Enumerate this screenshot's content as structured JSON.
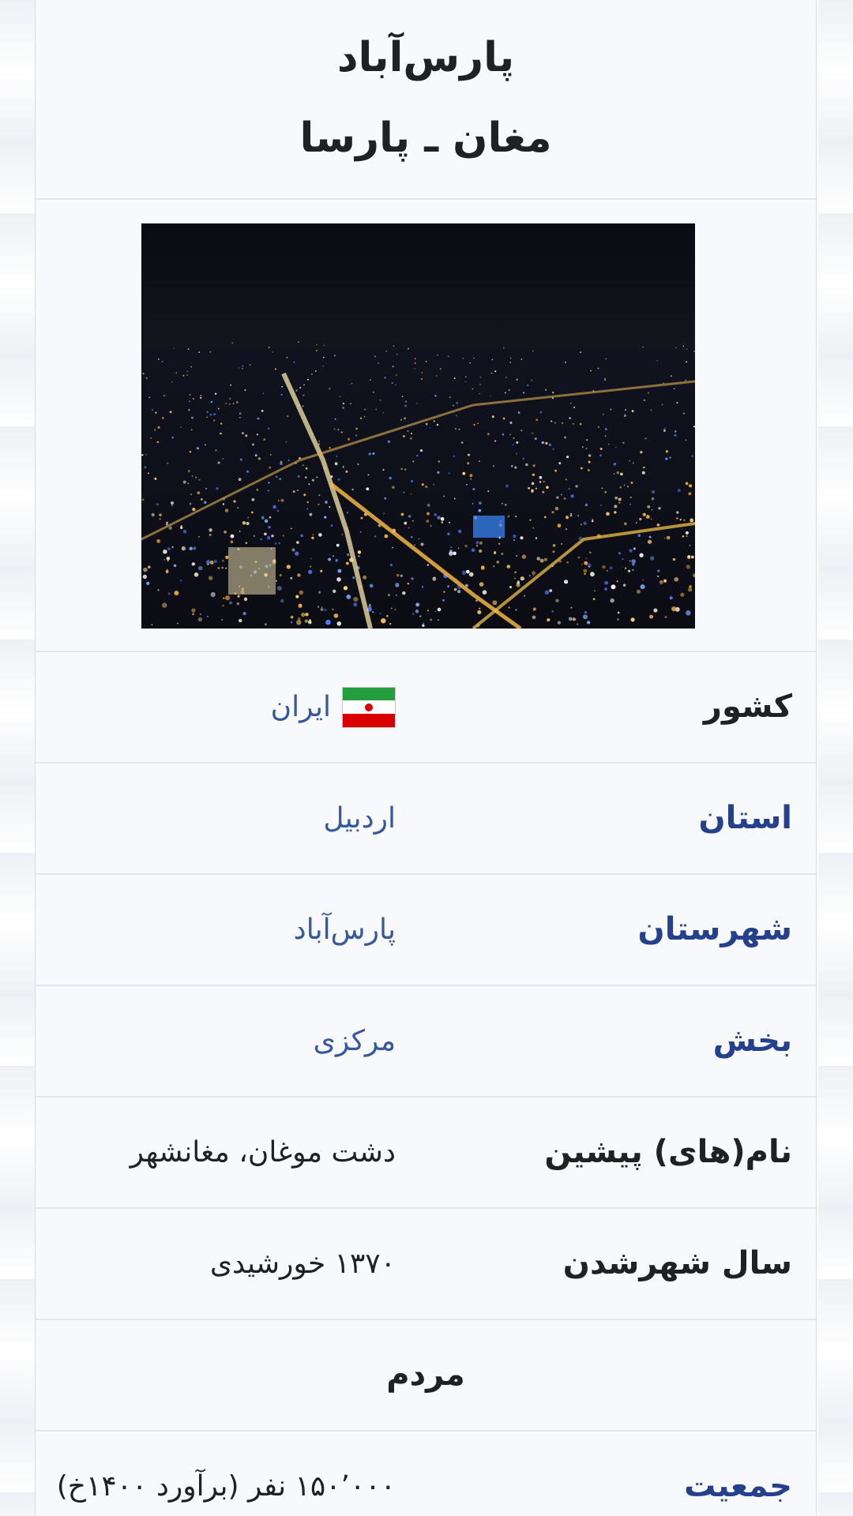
{
  "infobox": {
    "title": "پارس‌آباد",
    "subtitle": "مغان ـ پارسا"
  },
  "rows": [
    {
      "label": "کشور",
      "value": "ایران",
      "icon": "iran-flag-icon"
    },
    {
      "label": "استان",
      "value": "اردبیل"
    },
    {
      "label": "شهرستان",
      "value": "پارس‌آباد"
    },
    {
      "label": "بخش",
      "value": "مرکزی"
    },
    {
      "label": "نام(های) پیشین",
      "value": "دشت موغان، مغانشهر"
    },
    {
      "label": "سال شهرشدن",
      "value": "۱۳۷۰ خورشیدی"
    }
  ],
  "section": {
    "people": "مردم"
  },
  "population": {
    "label": "جمعیت",
    "value": "۱۵۰٬۰۰۰ نفر (برآورد ۱۴۰۰خ)"
  },
  "colors": {
    "link_label": "#25418e",
    "link_value": "#36589e",
    "background": "#f8f9fc",
    "divider": "#e3e6ec"
  }
}
